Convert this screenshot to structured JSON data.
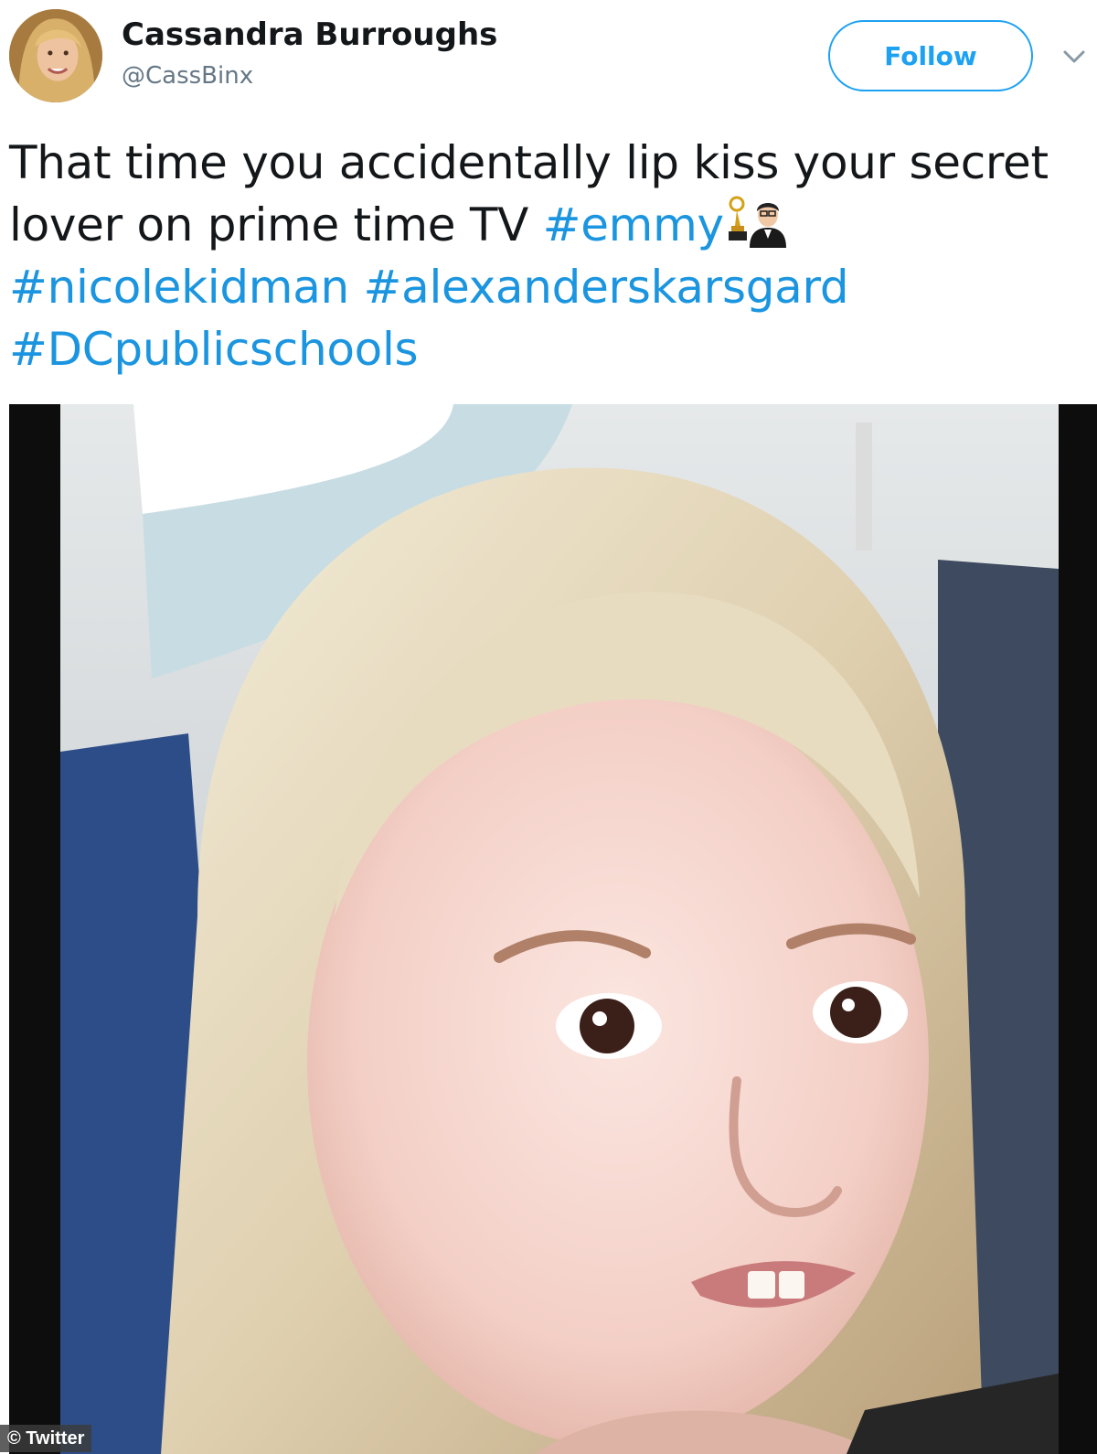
{
  "user": {
    "display_name": "Cassandra Burroughs",
    "handle": "@CassBinx",
    "avatar_icon": "avatar-photo"
  },
  "actions": {
    "follow_label": "Follow",
    "more_icon": "chevron-down-icon"
  },
  "tweet": {
    "line1": "That time you accidentally lip kiss your secret",
    "line2_text": "lover on prime time TV ",
    "hashtags": [
      "#emmy",
      "#nicolekidman",
      "#alexanderskarsgard",
      "#DCpublicschools"
    ],
    "emoji_icons": [
      "trophy-emoji",
      "man-in-tuxedo-emoji"
    ]
  },
  "media": {
    "credit": "© Twitter",
    "subject_icon": "media-photo"
  },
  "colors": {
    "link": "#1b95e0",
    "follow_border": "#1da1f2",
    "handle": "#657786",
    "text": "#14171a"
  }
}
